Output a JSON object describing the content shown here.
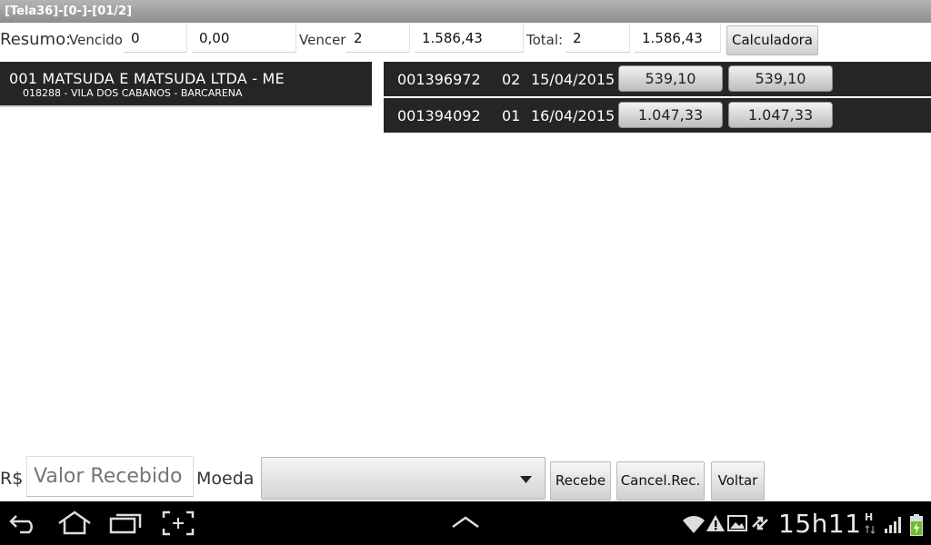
{
  "window": {
    "title": "[Tela36]-[0-]-[01/2]"
  },
  "summary": {
    "resumo_label": "Resumo:",
    "vencido_label": "Vencido",
    "vencido_count": "0",
    "vencido_value": "0,00",
    "vencer_label": "Vencer",
    "vencer_count": "2",
    "vencer_value": "1.586,43",
    "total_label": "Total:",
    "total_count": "2",
    "total_value": "1.586,43",
    "calculator_label": "Calculadora"
  },
  "client": {
    "name": "001 MATSUDA E MATSUDA LTDA - ME",
    "address": "018288 - VILA DOS CABANOS - BARCARENA"
  },
  "titles": [
    {
      "doc": "001396972",
      "parcel": "02",
      "due": "15/04/2015",
      "value": "539,10",
      "open_value": "539,10"
    },
    {
      "doc": "001394092",
      "parcel": "01",
      "due": "16/04/2015",
      "value": "1.047,33",
      "open_value": "1.047,33"
    }
  ],
  "payment": {
    "currency_symbol": "R$",
    "amount_placeholder": "Valor Recebido",
    "coin_label": "Moeda",
    "coin_selected": "",
    "receive_label": "Recebe",
    "cancel_label": "Cancel.Rec.",
    "back_label": "Voltar"
  },
  "statusbar": {
    "clock": "15h11",
    "network": "H"
  },
  "colors": {
    "row_bg": "#252525",
    "titlebar": "#9e9e9e",
    "navbar": "#000000"
  }
}
